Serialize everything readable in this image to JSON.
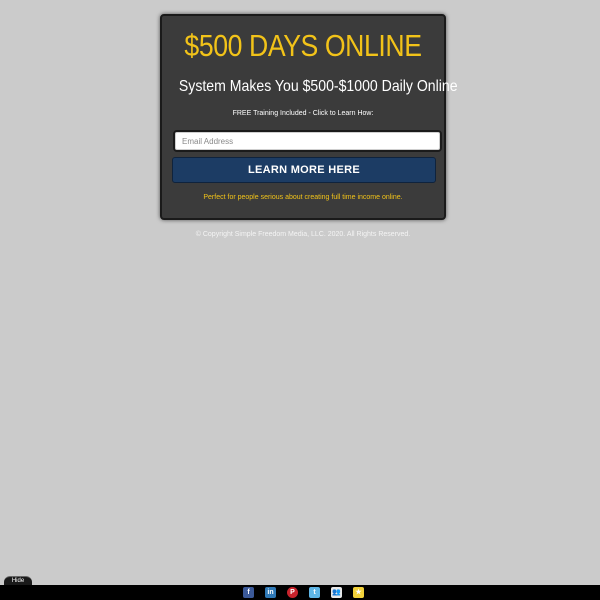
{
  "hero": {
    "headline": "$500 DAYS ONLINE",
    "subheadline": "System Makes You $500-$1000 Daily Online",
    "training_note": "FREE Training Included - Click to Learn How:"
  },
  "form": {
    "email_placeholder": "Email Address",
    "email_value": "",
    "submit_label": "LEARN MORE HERE"
  },
  "tagline": "Perfect for people serious about creating full time income online.",
  "footer": {
    "copyright": "© Copyright Simple Freedom Media, LLC. 2020. All Rights Reserved."
  },
  "share_bar": {
    "hide_label": "Hide",
    "icons": [
      {
        "name": "facebook-icon",
        "glyph": "f"
      },
      {
        "name": "linkedin-icon",
        "glyph": "in"
      },
      {
        "name": "pinterest-icon",
        "glyph": "P"
      },
      {
        "name": "twitter-icon",
        "glyph": "t"
      },
      {
        "name": "myspace-icon",
        "glyph": "👥"
      },
      {
        "name": "favorite-icon",
        "glyph": "★"
      }
    ]
  },
  "colors": {
    "background": "#cbcbcb",
    "card": "#3b3b3b",
    "accent_yellow": "#f2c319",
    "button_blue": "#1c3c64"
  }
}
